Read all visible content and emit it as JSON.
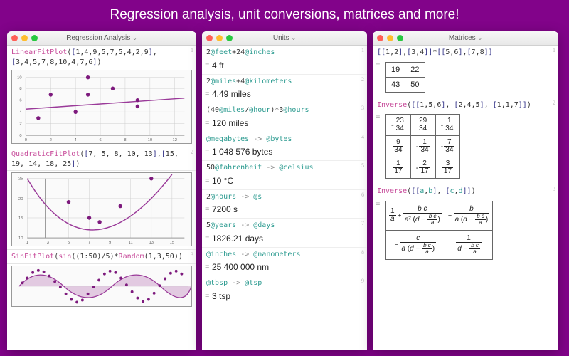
{
  "banner": "Regression analysis, unit conversions, matrices and more!",
  "windows": {
    "regression": {
      "title": "Regression Analysis",
      "cells": [
        {
          "n": 1,
          "in_parts": [
            "LinearFitPlot",
            "([",
            "1,4,9,5,7,5,4,2,9",
            "],[",
            "3,4,5,7,8,10,4,7,6",
            "])"
          ]
        },
        {
          "n": 2,
          "in_parts": [
            "QuadraticFitPlot",
            "([",
            "7, 5, 8, 10, 13",
            "],[",
            "15, 19, 14, 18, 25",
            "])"
          ]
        },
        {
          "n": 3,
          "in_parts": [
            "SinFitPlot",
            "(",
            "sin",
            "((",
            "1:50",
            ")/",
            "5",
            ")*",
            "Random",
            "(",
            "1,3,50",
            "))"
          ]
        }
      ]
    },
    "units": {
      "title": "Units",
      "cells": [
        {
          "n": 1,
          "in": "2@feet+24@inches",
          "out": "4 ft"
        },
        {
          "n": 2,
          "in": "2@miles+4@kilometers",
          "out": "4.49 miles"
        },
        {
          "n": 3,
          "in": "(40@miles/@hour)*3@hours",
          "out": "120 miles"
        },
        {
          "n": 4,
          "in": "@megabytes -> @bytes",
          "out": "1 048 576 bytes"
        },
        {
          "n": 5,
          "in": "50@fahrenheit -> @celsius",
          "out": "10 °C"
        },
        {
          "n": 6,
          "in": "2@hours -> @s",
          "out": "7200 s"
        },
        {
          "n": 7,
          "in": "5@years -> @days",
          "out": "1826.21 days"
        },
        {
          "n": 8,
          "in": "@inches -> @nanometers",
          "out": "25 400 000 nm"
        },
        {
          "n": 9,
          "in": "@tbsp -> @tsp",
          "out": "3 tsp"
        }
      ]
    },
    "matrices": {
      "title": "Matrices",
      "cells": [
        {
          "n": 1,
          "in": "[[1,2],[3,4]]*[[5,6],[7,8]]",
          "out_matrix": [
            [
              "19",
              "22"
            ],
            [
              "43",
              "50"
            ]
          ]
        },
        {
          "n": 2,
          "in": "Inverse([[1,5,6], [2,4,5], [1,1,7]])",
          "out_fracs": [
            [
              {
                "s": "-",
                "t": "23",
                "b": "34"
              },
              {
                "s": "",
                "t": "29",
                "b": "34"
              },
              {
                "s": "-",
                "t": "1",
                "b": "34"
              }
            ],
            [
              {
                "s": "",
                "t": "9",
                "b": "34"
              },
              {
                "s": "-",
                "t": "1",
                "b": "34"
              },
              {
                "s": "-",
                "t": "7",
                "b": "34"
              }
            ],
            [
              {
                "s": "",
                "t": "1",
                "b": "17"
              },
              {
                "s": "-",
                "t": "2",
                "b": "17"
              },
              {
                "s": "",
                "t": "3",
                "b": "17"
              }
            ]
          ]
        },
        {
          "n": 3,
          "in": "Inverse([[a,b], [c,d]])",
          "out_sym": [
            [
              "1/a + bc / (a²(d − bc/a))",
              "− b / (a(d − bc/a))"
            ],
            [
              "− c / (a(d − bc/a))",
              "1 / (d − bc/a)"
            ]
          ]
        }
      ]
    }
  },
  "chart_data": [
    {
      "type": "scatter+line",
      "title": "LinearFitPlot",
      "x": [
        1,
        4,
        9,
        5,
        7,
        5,
        4,
        2,
        9
      ],
      "y": [
        3,
        4,
        5,
        7,
        8,
        10,
        4,
        7,
        6
      ],
      "fit": {
        "type": "linear",
        "slope": 0.25,
        "intercept": 4.5
      },
      "xlim": [
        0,
        13
      ],
      "ylim": [
        0,
        10
      ],
      "grid": true
    },
    {
      "type": "scatter+curve",
      "title": "QuadraticFitPlot",
      "x": [
        7,
        5,
        8,
        10,
        13
      ],
      "y": [
        15,
        19,
        14,
        18,
        25
      ],
      "fit": {
        "type": "quadratic"
      },
      "xlim": [
        0,
        15
      ],
      "ylim": [
        10,
        25
      ],
      "grid": true
    },
    {
      "type": "scatter+curve",
      "title": "SinFitPlot",
      "x_range": [
        1,
        50
      ],
      "series": "sin(x/5)*Random(1,3,50)",
      "fit": {
        "type": "sin"
      },
      "xlim": [
        0,
        50
      ],
      "ylim": [
        -3,
        3
      ],
      "grid": true
    }
  ]
}
